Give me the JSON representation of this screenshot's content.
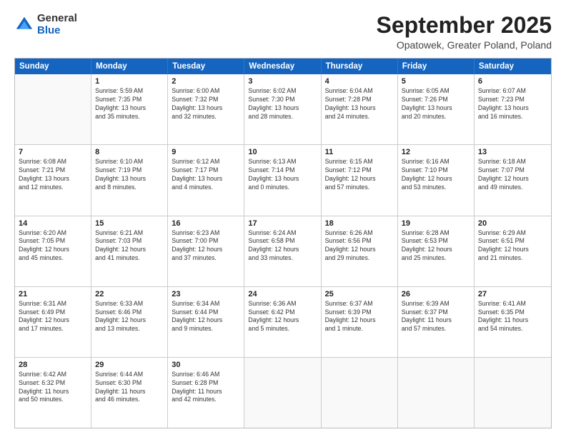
{
  "header": {
    "logo_general": "General",
    "logo_blue": "Blue",
    "month": "September 2025",
    "location": "Opatowek, Greater Poland, Poland"
  },
  "days_of_week": [
    "Sunday",
    "Monday",
    "Tuesday",
    "Wednesday",
    "Thursday",
    "Friday",
    "Saturday"
  ],
  "weeks": [
    [
      {
        "day": "",
        "info": ""
      },
      {
        "day": "1",
        "info": "Sunrise: 5:59 AM\nSunset: 7:35 PM\nDaylight: 13 hours\nand 35 minutes."
      },
      {
        "day": "2",
        "info": "Sunrise: 6:00 AM\nSunset: 7:32 PM\nDaylight: 13 hours\nand 32 minutes."
      },
      {
        "day": "3",
        "info": "Sunrise: 6:02 AM\nSunset: 7:30 PM\nDaylight: 13 hours\nand 28 minutes."
      },
      {
        "day": "4",
        "info": "Sunrise: 6:04 AM\nSunset: 7:28 PM\nDaylight: 13 hours\nand 24 minutes."
      },
      {
        "day": "5",
        "info": "Sunrise: 6:05 AM\nSunset: 7:26 PM\nDaylight: 13 hours\nand 20 minutes."
      },
      {
        "day": "6",
        "info": "Sunrise: 6:07 AM\nSunset: 7:23 PM\nDaylight: 13 hours\nand 16 minutes."
      }
    ],
    [
      {
        "day": "7",
        "info": "Sunrise: 6:08 AM\nSunset: 7:21 PM\nDaylight: 13 hours\nand 12 minutes."
      },
      {
        "day": "8",
        "info": "Sunrise: 6:10 AM\nSunset: 7:19 PM\nDaylight: 13 hours\nand 8 minutes."
      },
      {
        "day": "9",
        "info": "Sunrise: 6:12 AM\nSunset: 7:17 PM\nDaylight: 13 hours\nand 4 minutes."
      },
      {
        "day": "10",
        "info": "Sunrise: 6:13 AM\nSunset: 7:14 PM\nDaylight: 13 hours\nand 0 minutes."
      },
      {
        "day": "11",
        "info": "Sunrise: 6:15 AM\nSunset: 7:12 PM\nDaylight: 12 hours\nand 57 minutes."
      },
      {
        "day": "12",
        "info": "Sunrise: 6:16 AM\nSunset: 7:10 PM\nDaylight: 12 hours\nand 53 minutes."
      },
      {
        "day": "13",
        "info": "Sunrise: 6:18 AM\nSunset: 7:07 PM\nDaylight: 12 hours\nand 49 minutes."
      }
    ],
    [
      {
        "day": "14",
        "info": "Sunrise: 6:20 AM\nSunset: 7:05 PM\nDaylight: 12 hours\nand 45 minutes."
      },
      {
        "day": "15",
        "info": "Sunrise: 6:21 AM\nSunset: 7:03 PM\nDaylight: 12 hours\nand 41 minutes."
      },
      {
        "day": "16",
        "info": "Sunrise: 6:23 AM\nSunset: 7:00 PM\nDaylight: 12 hours\nand 37 minutes."
      },
      {
        "day": "17",
        "info": "Sunrise: 6:24 AM\nSunset: 6:58 PM\nDaylight: 12 hours\nand 33 minutes."
      },
      {
        "day": "18",
        "info": "Sunrise: 6:26 AM\nSunset: 6:56 PM\nDaylight: 12 hours\nand 29 minutes."
      },
      {
        "day": "19",
        "info": "Sunrise: 6:28 AM\nSunset: 6:53 PM\nDaylight: 12 hours\nand 25 minutes."
      },
      {
        "day": "20",
        "info": "Sunrise: 6:29 AM\nSunset: 6:51 PM\nDaylight: 12 hours\nand 21 minutes."
      }
    ],
    [
      {
        "day": "21",
        "info": "Sunrise: 6:31 AM\nSunset: 6:49 PM\nDaylight: 12 hours\nand 17 minutes."
      },
      {
        "day": "22",
        "info": "Sunrise: 6:33 AM\nSunset: 6:46 PM\nDaylight: 12 hours\nand 13 minutes."
      },
      {
        "day": "23",
        "info": "Sunrise: 6:34 AM\nSunset: 6:44 PM\nDaylight: 12 hours\nand 9 minutes."
      },
      {
        "day": "24",
        "info": "Sunrise: 6:36 AM\nSunset: 6:42 PM\nDaylight: 12 hours\nand 5 minutes."
      },
      {
        "day": "25",
        "info": "Sunrise: 6:37 AM\nSunset: 6:39 PM\nDaylight: 12 hours\nand 1 minute."
      },
      {
        "day": "26",
        "info": "Sunrise: 6:39 AM\nSunset: 6:37 PM\nDaylight: 11 hours\nand 57 minutes."
      },
      {
        "day": "27",
        "info": "Sunrise: 6:41 AM\nSunset: 6:35 PM\nDaylight: 11 hours\nand 54 minutes."
      }
    ],
    [
      {
        "day": "28",
        "info": "Sunrise: 6:42 AM\nSunset: 6:32 PM\nDaylight: 11 hours\nand 50 minutes."
      },
      {
        "day": "29",
        "info": "Sunrise: 6:44 AM\nSunset: 6:30 PM\nDaylight: 11 hours\nand 46 minutes."
      },
      {
        "day": "30",
        "info": "Sunrise: 6:46 AM\nSunset: 6:28 PM\nDaylight: 11 hours\nand 42 minutes."
      },
      {
        "day": "",
        "info": ""
      },
      {
        "day": "",
        "info": ""
      },
      {
        "day": "",
        "info": ""
      },
      {
        "day": "",
        "info": ""
      }
    ]
  ]
}
